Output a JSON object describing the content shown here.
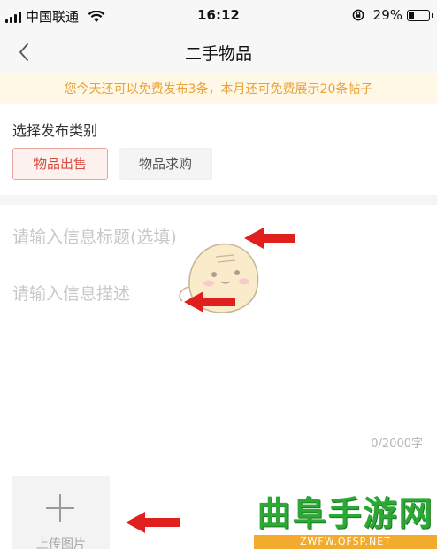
{
  "status_bar": {
    "carrier": "中国联通",
    "time": "16:12",
    "battery_percent": "29%",
    "battery_level": 0.29,
    "icons": [
      "signal-icon",
      "wifi-icon",
      "orientation-lock-icon",
      "battery-icon"
    ]
  },
  "nav": {
    "back_icon": "chevron-left-icon",
    "title": "二手物品"
  },
  "notice": "您今天还可以免费发布3条，本月还可免费展示20条帖子",
  "category": {
    "label": "选择发布类别",
    "options": [
      "物品出售",
      "物品求购"
    ],
    "selected": "物品出售"
  },
  "form": {
    "title_placeholder": "请输入信息标题(选填)",
    "description_placeholder": "请输入信息描述",
    "char_count": "0/2000字"
  },
  "upload": {
    "icon": "plus-icon",
    "label": "上传图片"
  },
  "watermark": {
    "title": "曲阜手游网",
    "subtitle": "ZWFW.QFSP.NET"
  },
  "colors": {
    "accent_red": "#d84c3f",
    "notice_bg": "#fff8e6",
    "notice_text": "#e8a23c",
    "arrow_red": "#e0201c",
    "watermark_green": "#2ba934",
    "watermark_orange": "#f2ab2c"
  }
}
